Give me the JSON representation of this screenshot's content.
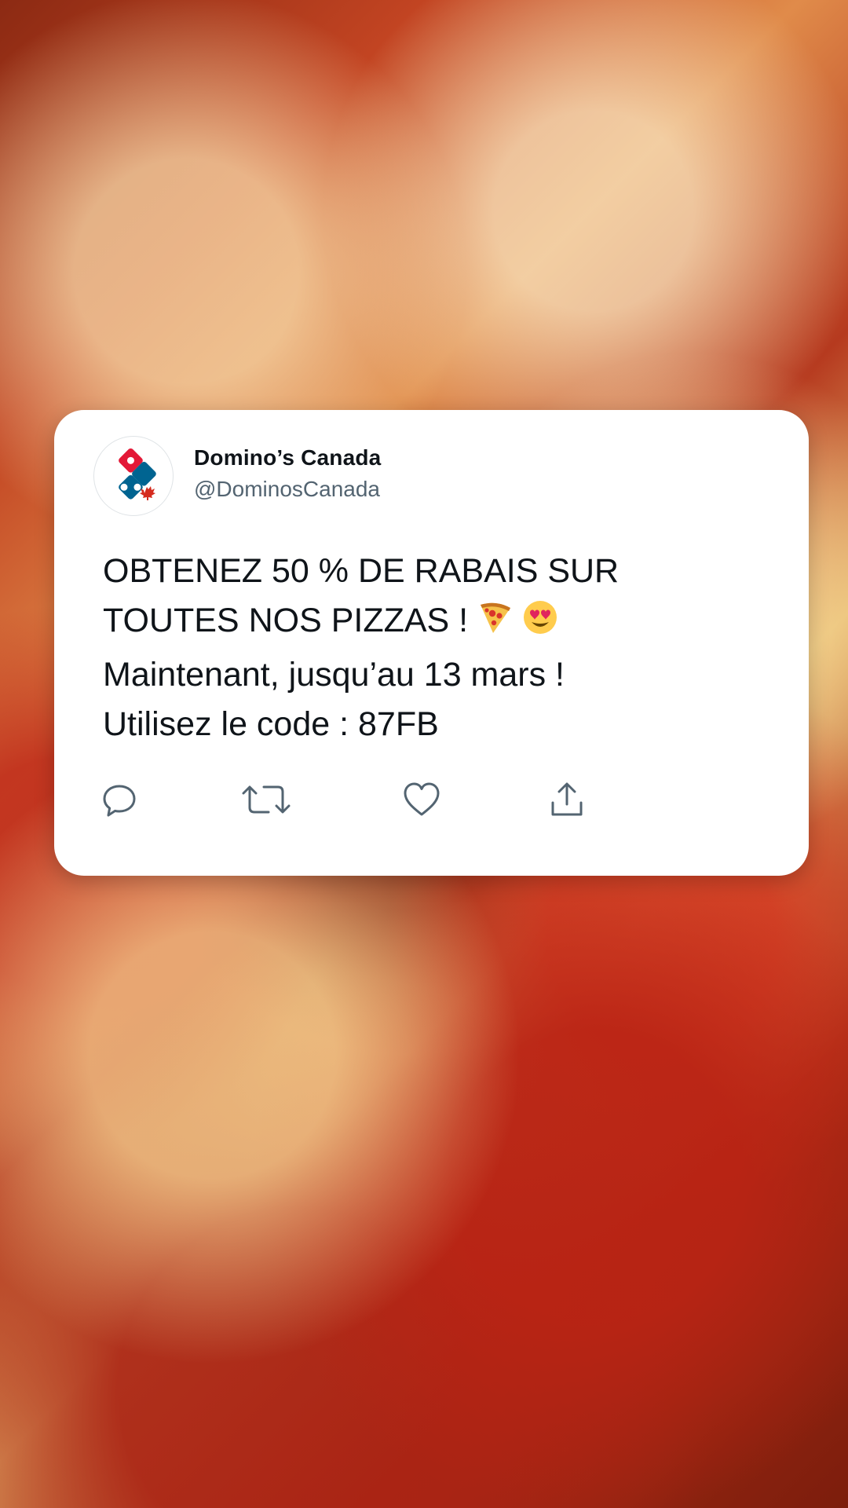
{
  "tweet": {
    "author_name": "Domino’s Canada",
    "author_handle": "@DominosCanada",
    "text_lines": [
      "OBTENEZ 50 % DE RABAIS SUR",
      "TOUTES NOS PIZZAS !",
      "Maintenant, jusqu’au 13 mars !",
      "Utilisez le code : 87FB"
    ],
    "emojis": [
      "pizza-emoji",
      "heart-eyes-emoji"
    ]
  },
  "actions": [
    {
      "icon": "reply-icon"
    },
    {
      "icon": "retweet-icon"
    },
    {
      "icon": "like-icon"
    },
    {
      "icon": "share-icon"
    }
  ],
  "colors": {
    "text_primary": "#0f1419",
    "text_secondary": "#536471",
    "icon_gray": "#536471",
    "brand_red": "#e31837",
    "brand_blue": "#006491"
  }
}
